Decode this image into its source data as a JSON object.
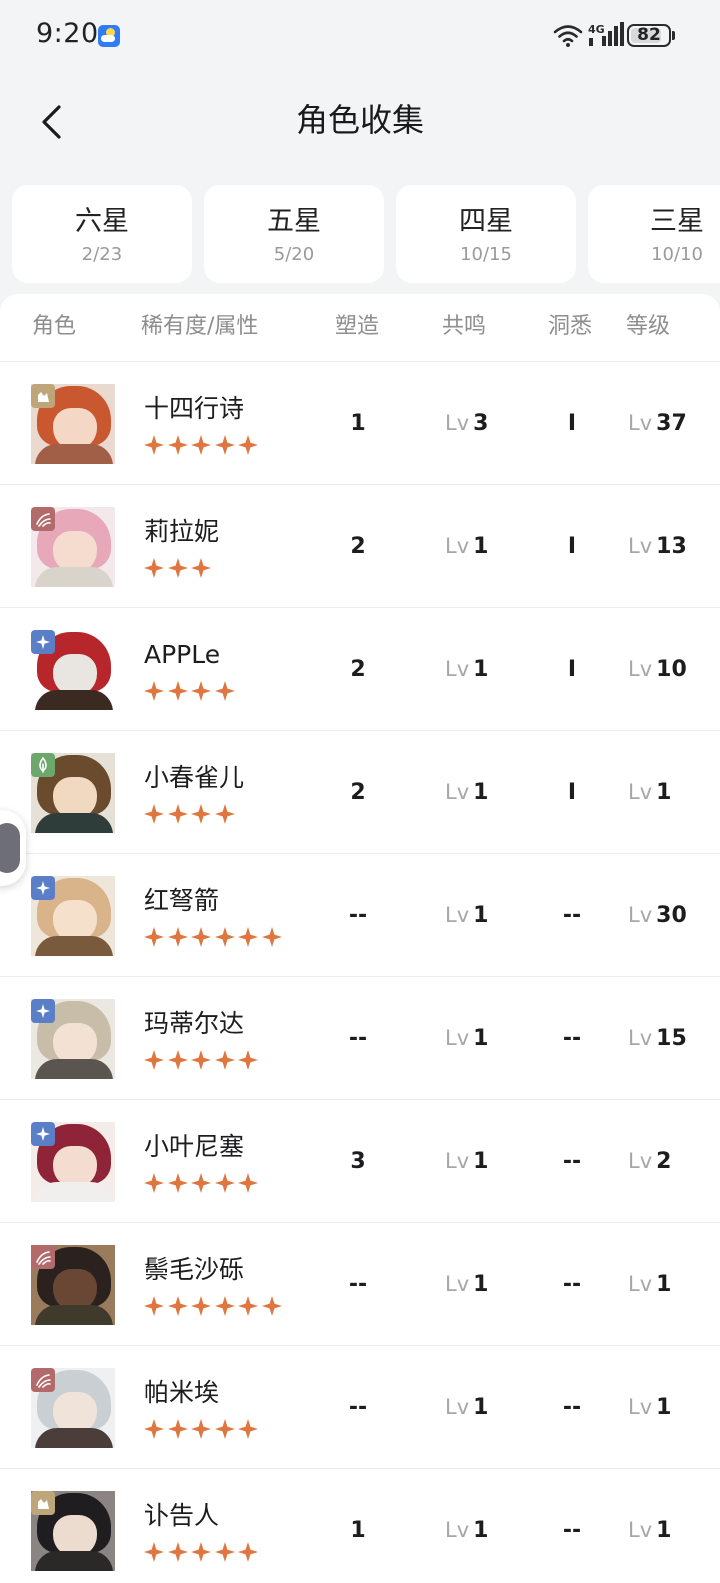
{
  "status_bar": {
    "time": "9:20",
    "network_label": "4G",
    "battery": "82",
    "battery_level": 0.82,
    "icons": [
      "weather-app-icon",
      "wifi-icon",
      "cellular-signal-icon",
      "battery-icon"
    ]
  },
  "header": {
    "title": "角色收集",
    "back_icon": "chevron-left-icon"
  },
  "tabs": [
    {
      "name": "六星",
      "count": "2/23"
    },
    {
      "name": "五星",
      "count": "5/20"
    },
    {
      "name": "四星",
      "count": "10/15"
    },
    {
      "name": "三星",
      "count": "10/10"
    }
  ],
  "list_header": {
    "character": "角色",
    "rarity_attr": "稀有度/属性",
    "shaping": "塑造",
    "resonance": "共鸣",
    "insight": "洞悉",
    "level": "等级"
  },
  "lv_prefix": "Lv",
  "colors": {
    "star": "#e0763f",
    "attr_beast": "#bfa57a",
    "attr_passion": "#b26a6a",
    "attr_star": "#5b7fc7",
    "attr_plant": "#6ca86b"
  },
  "characters": [
    {
      "name": "十四行诗",
      "stars": 5,
      "attr": "beast",
      "shaping": "1",
      "resonance": "3",
      "insight": "I",
      "level": "37"
    },
    {
      "name": "莉拉妮",
      "stars": 3,
      "attr": "passion",
      "shaping": "2",
      "resonance": "1",
      "insight": "I",
      "level": "13"
    },
    {
      "name": "APPLe",
      "stars": 4,
      "attr": "star",
      "shaping": "2",
      "resonance": "1",
      "insight": "I",
      "level": "10"
    },
    {
      "name": "小春雀儿",
      "stars": 4,
      "attr": "plant",
      "shaping": "2",
      "resonance": "1",
      "insight": "I",
      "level": "1"
    },
    {
      "name": "红弩箭",
      "stars": 6,
      "attr": "star",
      "shaping": "--",
      "resonance": "1",
      "insight": "--",
      "level": "30"
    },
    {
      "name": "玛蒂尔达",
      "stars": 5,
      "attr": "star",
      "shaping": "--",
      "resonance": "1",
      "insight": "--",
      "level": "15"
    },
    {
      "name": "小叶尼塞",
      "stars": 5,
      "attr": "star",
      "shaping": "3",
      "resonance": "1",
      "insight": "--",
      "level": "2"
    },
    {
      "name": "鬃毛沙砾",
      "stars": 6,
      "attr": "passion",
      "shaping": "--",
      "resonance": "1",
      "insight": "--",
      "level": "1"
    },
    {
      "name": "帕米埃",
      "stars": 5,
      "attr": "passion",
      "shaping": "--",
      "resonance": "1",
      "insight": "--",
      "level": "1"
    },
    {
      "name": "讣告人",
      "stars": 5,
      "attr": "beast",
      "shaping": "1",
      "resonance": "1",
      "insight": "--",
      "level": "1"
    }
  ]
}
